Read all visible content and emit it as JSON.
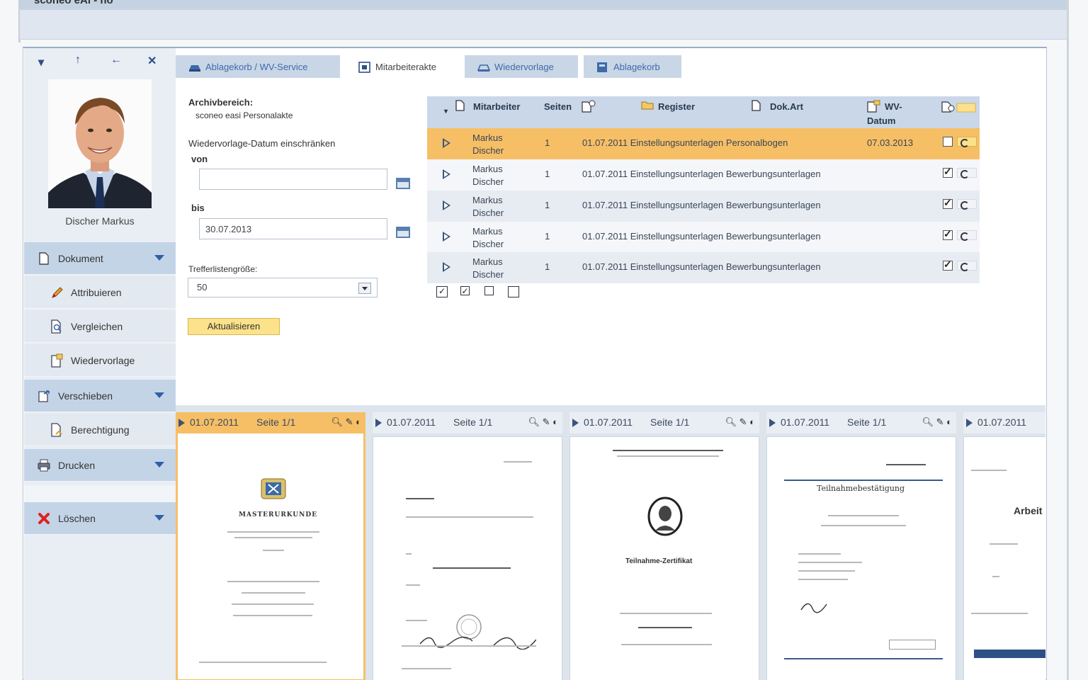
{
  "window": {
    "title": "sconeo eAl - ho"
  },
  "person": {
    "name": "Discher Markus"
  },
  "sidebar": {
    "items": [
      {
        "label": "Dokument",
        "level": "main",
        "icon": "document-icon"
      },
      {
        "label": "Attribuieren",
        "level": "sub",
        "icon": "pencil-icon"
      },
      {
        "label": "Vergleichen",
        "level": "sub",
        "icon": "compare-icon"
      },
      {
        "label": "Wiedervorlage",
        "level": "sub",
        "icon": "resubmission-icon"
      },
      {
        "label": "Verschieben",
        "level": "main",
        "icon": "move-icon"
      },
      {
        "label": "Berechtigung",
        "level": "sub",
        "icon": "permission-icon"
      },
      {
        "label": "Drucken",
        "level": "main",
        "icon": "printer-icon"
      },
      {
        "label": "Löschen",
        "level": "main",
        "icon": "delete-icon"
      }
    ]
  },
  "tabs": [
    {
      "label": "Ablagekorb / WV-Service",
      "active": false
    },
    {
      "label": "Mitarbeiterakte",
      "active": true
    },
    {
      "label": "Wiedervorlage",
      "active": false
    },
    {
      "label": "Ablagekorb",
      "active": false
    }
  ],
  "filter": {
    "archive_label": "Archivbereich:",
    "archive_value": "sconeo easi Personalakte",
    "restrict_label": "Wiedervorlage-Datum einschränken",
    "from_label": "von",
    "from_value": "",
    "to_label": "bis",
    "to_value": "30.07.2013",
    "listsize_label": "Trefferlistengröße:",
    "listsize_value": "50",
    "update_button": "Aktualisieren"
  },
  "table": {
    "headers": {
      "employee": "Mitarbeiter",
      "pages": "Seiten",
      "register": "Register",
      "doctype": "Dok.Art",
      "wv_date_1": "WV-",
      "wv_date_2": "Datum"
    },
    "rows": [
      {
        "name_1": "Markus",
        "name_2": "Discher",
        "pages": "1",
        "register": "01.07.2011 Einstellungsunterlagen Personalbogen",
        "date": "07.03.2013",
        "checked": false,
        "selected": true
      },
      {
        "name_1": "Markus",
        "name_2": "Discher",
        "pages": "1",
        "register": "01.07.2011 Einstellungsunterlagen Bewerbungsunterlagen",
        "date": "",
        "checked": true,
        "selected": false
      },
      {
        "name_1": "Markus",
        "name_2": "Discher",
        "pages": "1",
        "register": "01.07.2011 Einstellungsunterlagen Bewerbungsunterlagen",
        "date": "",
        "checked": true,
        "selected": false
      },
      {
        "name_1": "Markus",
        "name_2": "Discher",
        "pages": "1",
        "register": "01.07.2011 Einstellungsunterlagen Bewerbungsunterlagen",
        "date": "",
        "checked": true,
        "selected": false
      },
      {
        "name_1": "Markus",
        "name_2": "Discher",
        "pages": "1",
        "register": "01.07.2011 Einstellungsunterlagen Bewerbungsunterlagen",
        "date": "",
        "checked": true,
        "selected": false
      }
    ]
  },
  "thumbnails": [
    {
      "date": "01.07.2011",
      "page": "Seite 1/1",
      "selected": true,
      "doc": "MASTERURKUNDE"
    },
    {
      "date": "01.07.2011",
      "page": "Seite 1/1",
      "selected": false,
      "doc": ""
    },
    {
      "date": "01.07.2011",
      "page": "Seite 1/1",
      "selected": false,
      "doc": "Teilnahme-Zertifikat"
    },
    {
      "date": "01.07.2011",
      "page": "Seite 1/1",
      "selected": false,
      "doc": "Teilnahmebestätigung"
    },
    {
      "date": "01.07.2011",
      "page": "",
      "selected": false,
      "doc": "Arbeit"
    }
  ],
  "colors": {
    "accent": "#f6bf66",
    "sidebar_main": "#c4d4e7",
    "header": "#c9d7e8",
    "link": "#3f6aa8"
  }
}
